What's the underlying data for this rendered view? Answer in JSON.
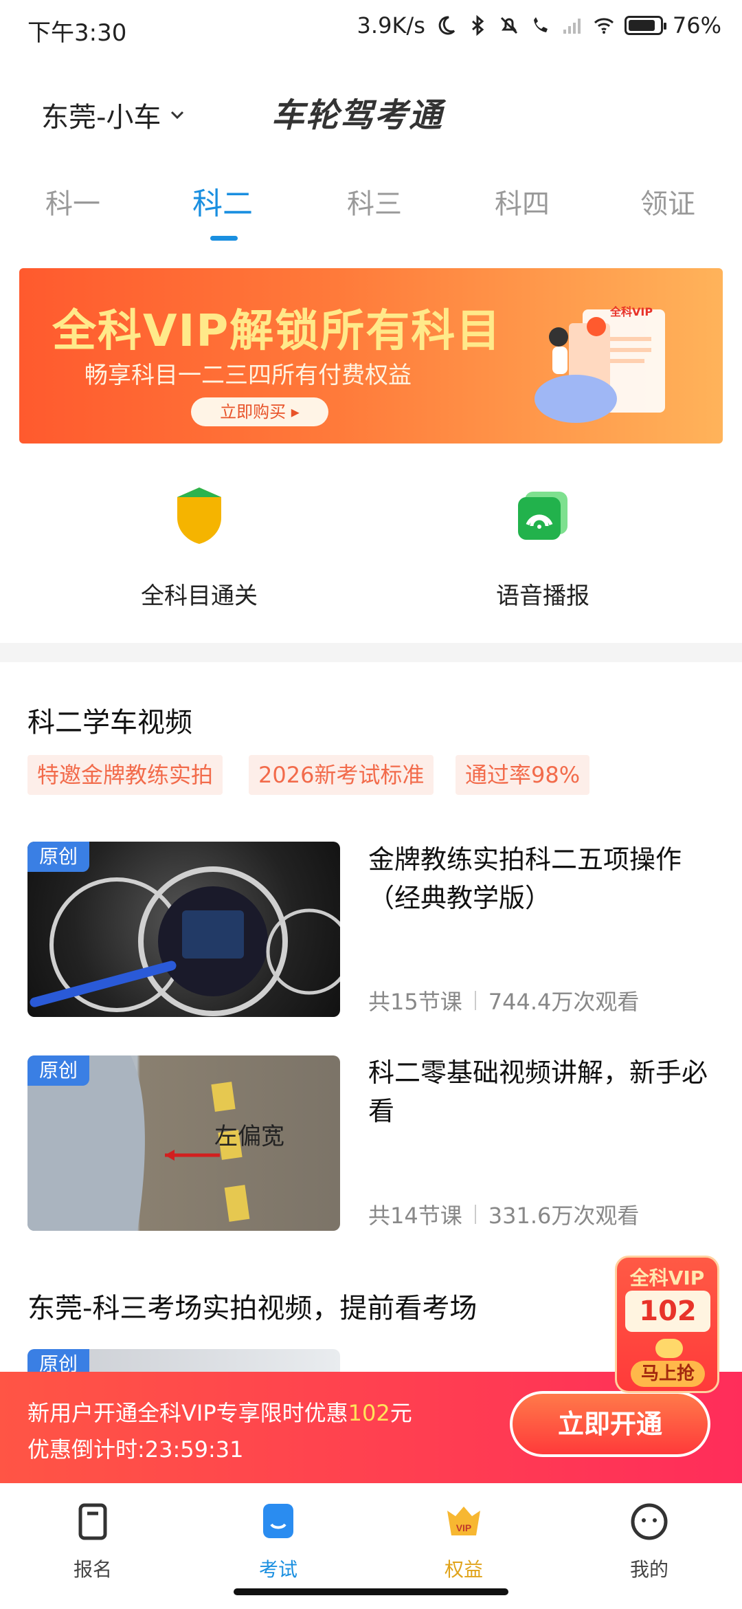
{
  "status_bar": {
    "time": "下午3:30",
    "net_speed": "3.9K/s",
    "battery": "76%"
  },
  "header": {
    "city": "东莞-小车",
    "logo": "车轮驾考通"
  },
  "tabs": [
    {
      "label": "科一",
      "active": false
    },
    {
      "label": "科二",
      "active": true
    },
    {
      "label": "科三",
      "active": false
    },
    {
      "label": "科四",
      "active": false
    },
    {
      "label": "领证",
      "active": false
    }
  ],
  "banner": {
    "title": "全科VIP解锁所有科目",
    "subtitle": "畅享科目一二三四所有付费权益",
    "button": "立即购买 ▸",
    "badge": "全科VIP"
  },
  "features": [
    {
      "label": "全科目通关",
      "icon": "shield-icon",
      "color": "#f5b400"
    },
    {
      "label": "语音播报",
      "icon": "broadcast-icon",
      "color": "#22b24c"
    }
  ],
  "section": {
    "title": "科二学车视频",
    "chips": [
      "特邀金牌教练实拍",
      "2026新考试标准",
      "通过率98%"
    ]
  },
  "videos": [
    {
      "tag": "原创",
      "title": "金牌教练实拍科二五项操作（经典教学版）",
      "lessons": "共15节课",
      "views": "744.4万次观看"
    },
    {
      "tag": "原创",
      "title": "科二零基础视频讲解，新手必看",
      "lessons": "共14节课",
      "views": "331.6万次观看",
      "overlay_text": "左偏宽"
    }
  ],
  "section2": {
    "title": "东莞-科三考场实拍视频，提前看考场",
    "tag": "原创"
  },
  "promo": {
    "line1_prefix": "新用户开通全科VIP专享限时优惠",
    "line1_amount": "102",
    "line1_suffix": "元",
    "countdown_label": "优惠倒计时:",
    "countdown": "23:59:31",
    "button": "立即开通"
  },
  "floating_vip": {
    "title": "全科VIP",
    "amount": "102",
    "grab": "马上抢"
  },
  "nav": [
    {
      "label": "报名",
      "icon": "signup-icon",
      "active": false
    },
    {
      "label": "考试",
      "icon": "exam-icon",
      "active": true
    },
    {
      "label": "权益",
      "icon": "vip-icon",
      "active": false
    },
    {
      "label": "我的",
      "icon": "profile-icon",
      "active": false
    }
  ],
  "colors": {
    "accent": "#1a8fe0",
    "promo": "#ff3a4a",
    "chip_text": "#f26b4b"
  }
}
